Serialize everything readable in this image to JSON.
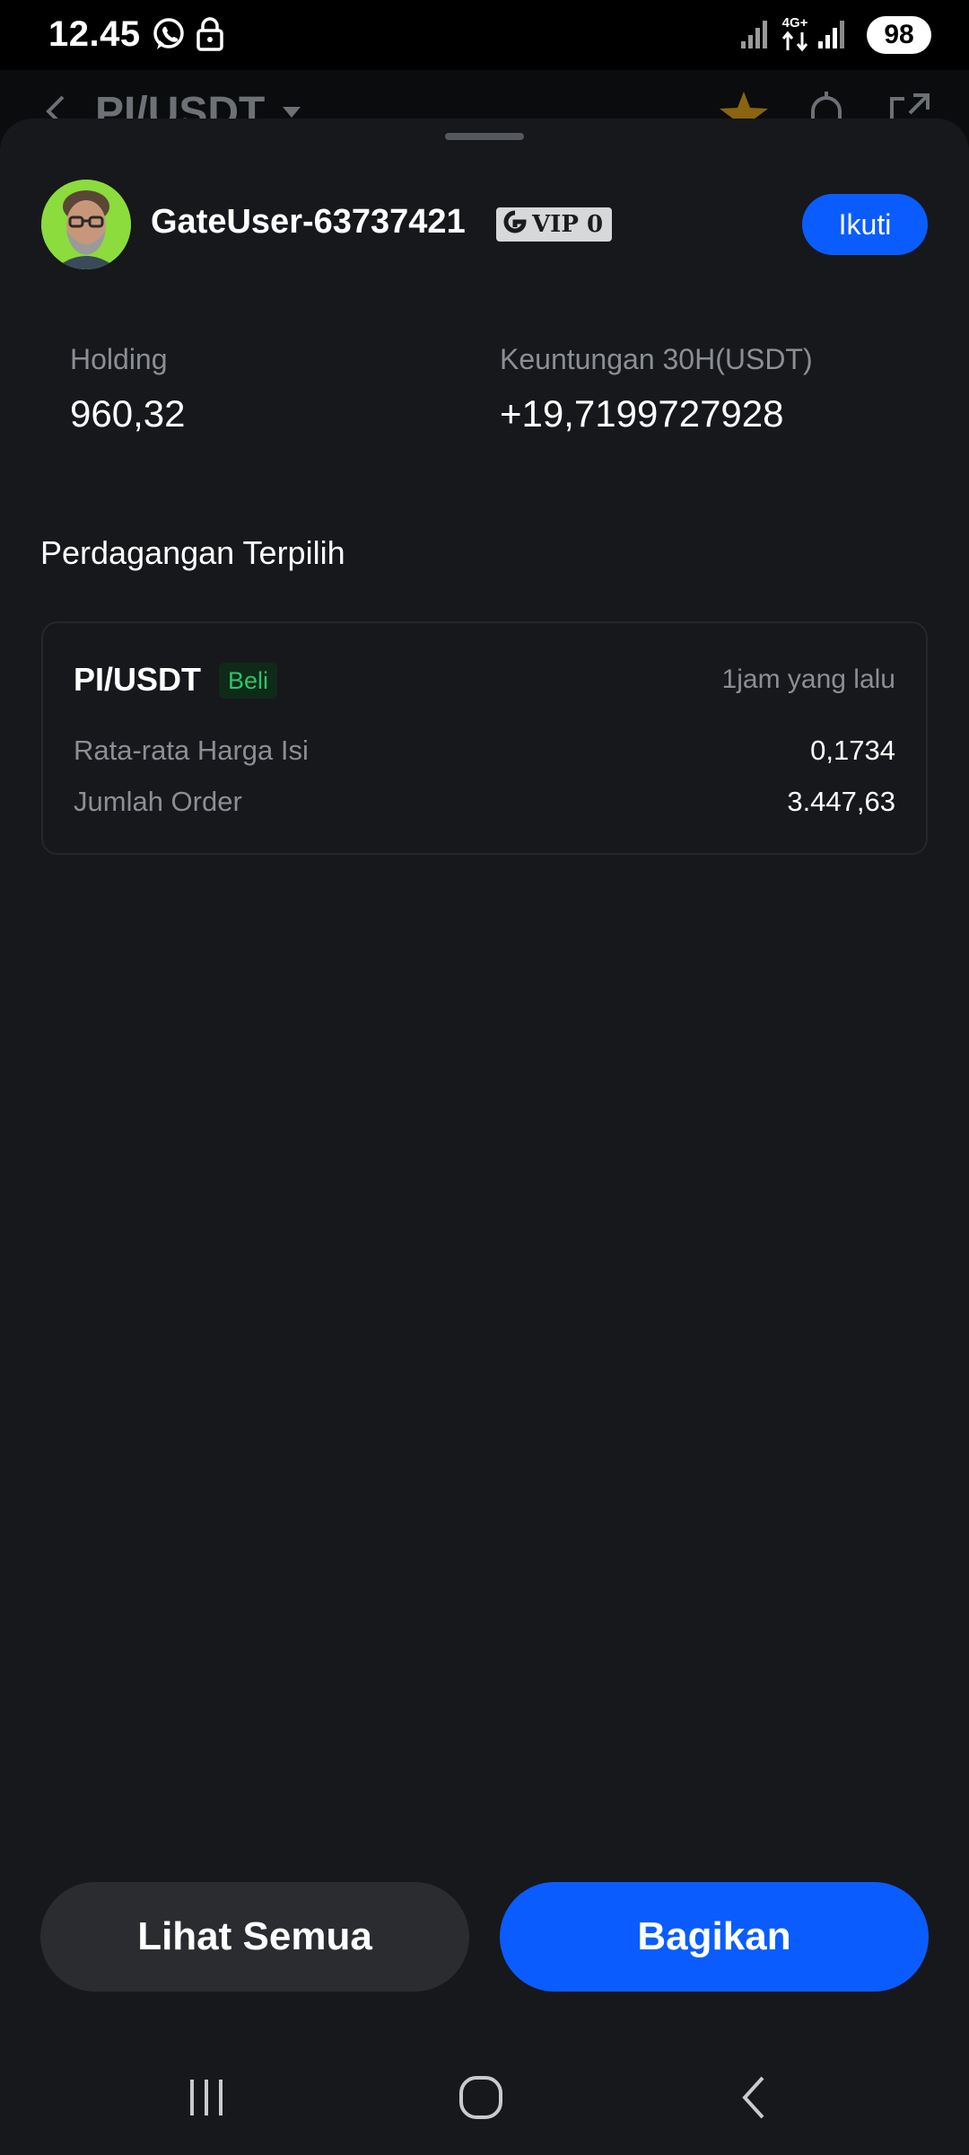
{
  "status_bar": {
    "time": "12.45",
    "network": "4G+",
    "battery": "98",
    "icons": [
      "whatsapp-icon",
      "lock-icon",
      "signal-icon",
      "data-arrows-icon",
      "signal-icon"
    ]
  },
  "background_header": {
    "title": "PI/USDT",
    "icons": [
      "back-arrow-icon",
      "caret-down-icon",
      "star-icon",
      "bell-icon",
      "share-icon"
    ]
  },
  "profile": {
    "username": "GateUser-63737421",
    "vip_label": "VIP 0",
    "follow_label": "Ikuti"
  },
  "stats": {
    "holding_label": "Holding",
    "holding_value": "960,32",
    "profit_label": "Keuntungan 30H(USDT)",
    "profit_value": "+19,7199727928"
  },
  "section_title": "Perdagangan Terpilih",
  "trade": {
    "pair": "PI/USDT",
    "side": "Beli",
    "time": "1jam yang lalu",
    "avg_price_label": "Rata-rata Harga Isi",
    "avg_price_value": "0,1734",
    "order_amount_label": "Jumlah Order",
    "order_amount_value": "3.447,63"
  },
  "actions": {
    "view_all_label": "Lihat Semua",
    "share_label": "Bagikan"
  },
  "colors": {
    "accent_blue": "#0a5cff",
    "buy_green": "#2bc46a",
    "sheet_bg": "#17181b",
    "muted_text": "#8b8e93",
    "star_gold": "#b8860b"
  }
}
